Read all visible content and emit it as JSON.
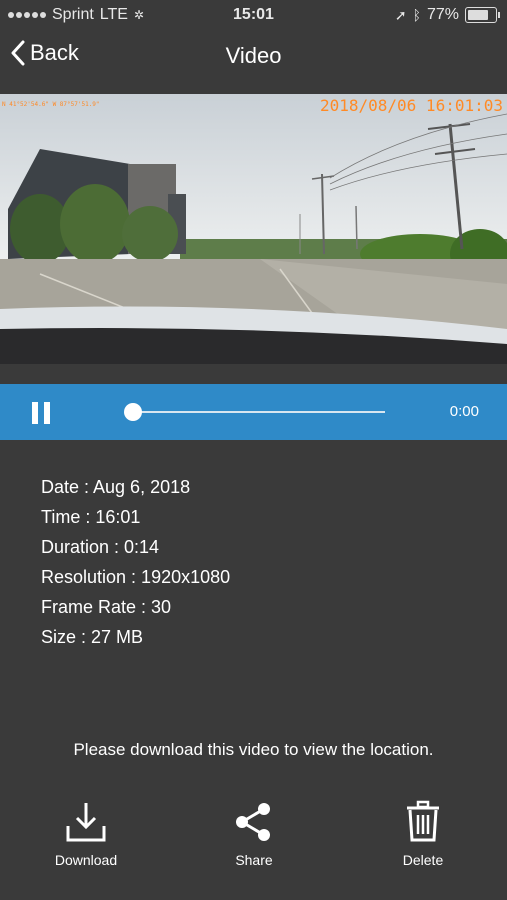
{
  "status_bar": {
    "carrier": "Sprint",
    "network": "LTE",
    "time": "15:01",
    "battery": "77%",
    "battery_level": 0.77
  },
  "nav": {
    "back_label": "Back",
    "title": "Video"
  },
  "video": {
    "overlay_timestamp": "2018/08/06 16:01:03",
    "overlay_coords": "N 41°52'54.6\" W 87°57'51.9\""
  },
  "player": {
    "position": "0:00",
    "progress": 0.0
  },
  "details": {
    "date": "Date : Aug 6, 2018",
    "time": "Time : 16:01",
    "duration": "Duration : 0:14",
    "resolution": "Resolution : 1920x1080",
    "frame_rate": "Frame Rate : 30",
    "size": "Size : 27 MB"
  },
  "location_note": "Please download this video to view the location.",
  "actions": {
    "download": "Download",
    "share": "Share",
    "delete": "Delete"
  }
}
